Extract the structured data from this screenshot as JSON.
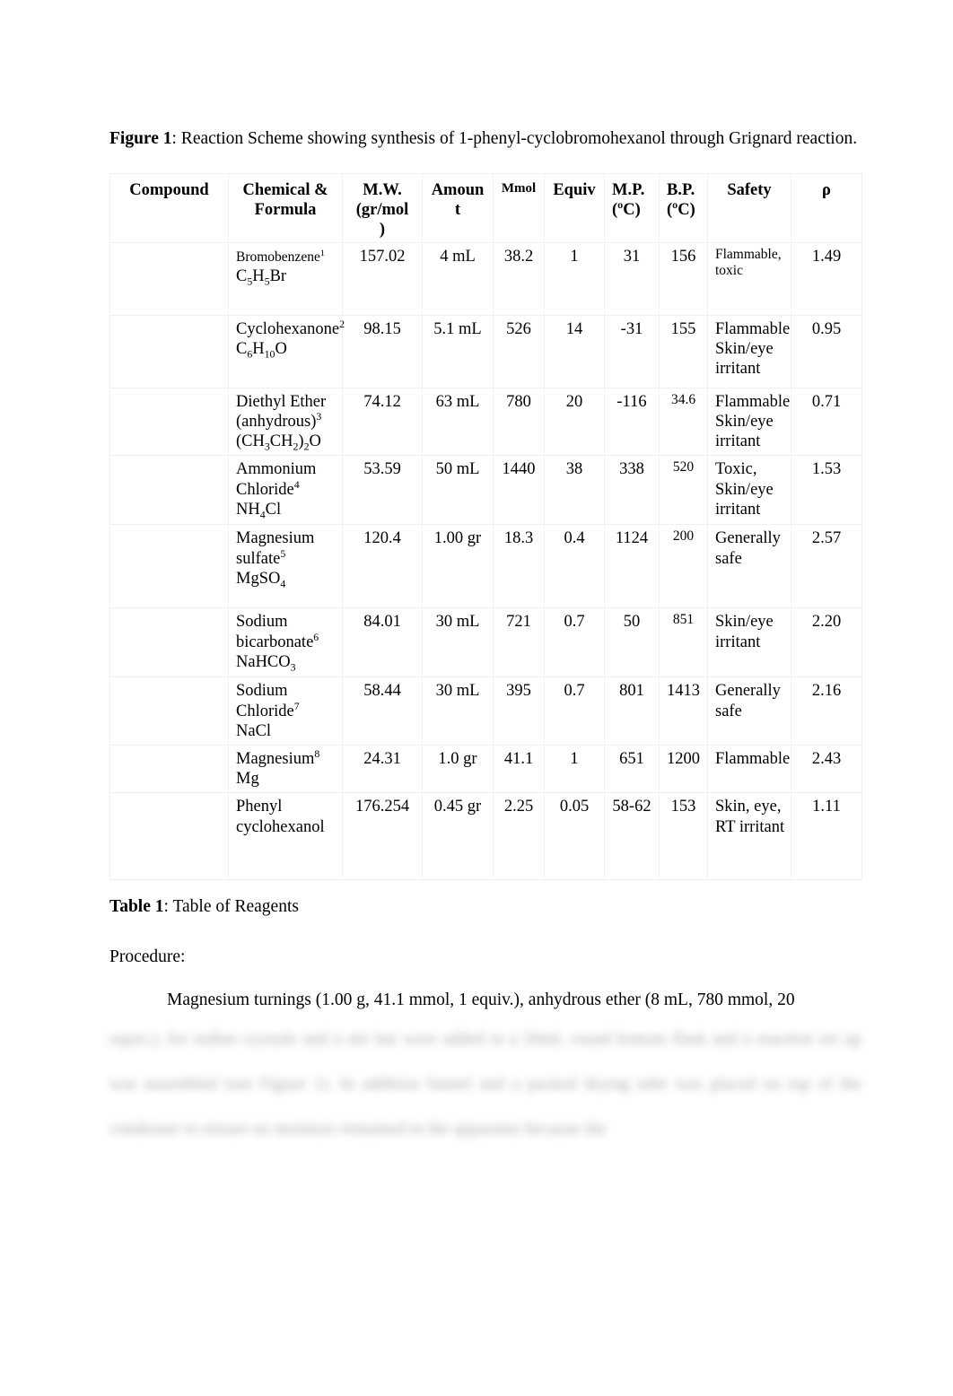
{
  "document": {
    "figure_caption": {
      "lead": "Figure 1",
      "text": ": Reaction Scheme showing synthesis of 1-phenyl-cyclobromohexanol through Grignard reaction."
    },
    "table_caption": {
      "lead": "Table 1",
      "text": ": Table of Reagents"
    },
    "procedure_heading": "Procedure:",
    "procedure_first_line": "Magnesium turnings (1.00 g, 41.1 mmol, 1 equiv.), anhydrous ether (8 mL, 780 mmol, 20",
    "obscured_text": "equiv.), for iodine crystals and a stir bar were added to a 50mL round bottom flask and a reaction set up was assembled (see Figure 1). In addition funnel and a packed drying tube was placed on top of the condenser to ensure no moisture remained in the apparatus because the"
  },
  "table": {
    "headers": [
      {
        "label": "Compound",
        "align": "center",
        "size": "normal"
      },
      {
        "label": "Chemical & Formula",
        "align": "center",
        "size": "normal"
      },
      {
        "label": "M.W. (gr/mol)",
        "align": "center",
        "size": "normal"
      },
      {
        "label": "Amount",
        "align": "center",
        "size": "normal"
      },
      {
        "label": "Mmol",
        "align": "center",
        "size": "small"
      },
      {
        "label": "Equiv",
        "align": "center",
        "size": "normal"
      },
      {
        "label": "M.P. (ºC)",
        "align": "left",
        "size": "normal"
      },
      {
        "label": "B.P. (ºC)",
        "align": "left",
        "size": "normal"
      },
      {
        "label": "Safety",
        "align": "center",
        "size": "normal"
      },
      {
        "label": "ρ",
        "align": "center",
        "size": "normal"
      }
    ],
    "header_cells": {
      "compound": "Compound",
      "chemical_formula_l1": "Chemical &",
      "chemical_formula_l2": "Formula",
      "mw_l1": "M.W.",
      "mw_l2": "(gr/mol",
      "mw_l3": ")",
      "amount_l1": "Amoun",
      "amount_l2": "t",
      "mmol": "Mmol",
      "equiv": "Equiv",
      "mp_l1": "M.P.",
      "mp_l2": "(ºC)",
      "bp_l1": "B.P.",
      "bp_l2": "(ºC)",
      "safety": "Safety",
      "rho": "ρ"
    },
    "rows": [
      {
        "compound": "",
        "name": "Bromobenzene",
        "name_sup": "1",
        "formula_html": "C<sub>5</sub>H<sub>5</sub>Br",
        "mw": "157.02",
        "amount": "4 mL",
        "mmol": "38.2",
        "equiv": "1",
        "mp": "31",
        "bp": "156",
        "safety": "Flammable, toxic",
        "rho": "1.49"
      },
      {
        "compound": "",
        "name": "Cyclohexanone",
        "name_sup": "2",
        "formula_html": "C<sub>6</sub>H<sub>10</sub>O",
        "mw": "98.15",
        "amount": "5.1 mL",
        "mmol": "526",
        "equiv": "14",
        "mp": "-31",
        "bp": "155",
        "safety": "Flammable Skin/eye irritant",
        "rho": "0.95"
      },
      {
        "compound": "",
        "name": "Diethyl Ether (anhydrous)",
        "name_sup": "3",
        "formula_html": "(CH<sub>3</sub>CH<sub>2</sub>)<sub>2</sub>O",
        "mw": "74.12",
        "amount": "63 mL",
        "mmol": "780",
        "equiv": "20",
        "mp": "-116",
        "bp": "34.6",
        "safety": "Flammable Skin/eye irritant",
        "rho": "0.71"
      },
      {
        "compound": "",
        "name": "Ammonium Chloride",
        "name_sup": "4",
        "formula_html": "NH<sub>4</sub>Cl",
        "mw": "53.59",
        "amount": "50 mL",
        "mmol": "1440",
        "equiv": "38",
        "mp": "338",
        "bp": "520",
        "safety": "Toxic, Skin/eye irritant",
        "rho": "1.53"
      },
      {
        "compound": "",
        "name": "Magnesium sulfate",
        "name_sup": "5",
        "formula_html": "MgSO<sub>4</sub>",
        "mw": "120.4",
        "amount": "1.00 gr",
        "mmol": "18.3",
        "equiv": "0.4",
        "mp": "1124",
        "bp": "200",
        "safety": "Generally safe",
        "rho": "2.57"
      },
      {
        "compound": "",
        "name": "Sodium bicarbonate",
        "name_sup": "6",
        "formula_html": "NaHCO<sub>3</sub>",
        "mw": "84.01",
        "amount": "30 mL",
        "mmol": "721",
        "equiv": "0.7",
        "mp": "50",
        "bp": "851",
        "safety": "Skin/eye irritant",
        "rho": "2.20"
      },
      {
        "compound": "",
        "name": "Sodium Chloride",
        "name_sup": "7",
        "formula_html": "NaCl",
        "mw": "58.44",
        "amount": "30 mL",
        "mmol": "395",
        "equiv": "0.7",
        "mp": "801",
        "bp": "1413",
        "safety": "Generally safe",
        "rho": "2.16"
      },
      {
        "compound": "",
        "name": "Magnesium",
        "name_sup": "8",
        "formula_html": "Mg",
        "mw": "24.31",
        "amount": "1.0 gr",
        "mmol": "41.1",
        "equiv": "1",
        "mp": "651",
        "bp": "1200",
        "safety": "Flammable",
        "rho": "2.43"
      },
      {
        "compound": "",
        "name": "Phenyl cyclohexanol",
        "name_sup": "",
        "formula_html": "",
        "mw": "176.254",
        "amount": "0.45 gr",
        "mmol": "2.25",
        "equiv": "0.05",
        "mp": "58-62",
        "bp": "153",
        "safety": "Skin, eye, RT irritant",
        "rho": "1.11"
      }
    ]
  }
}
